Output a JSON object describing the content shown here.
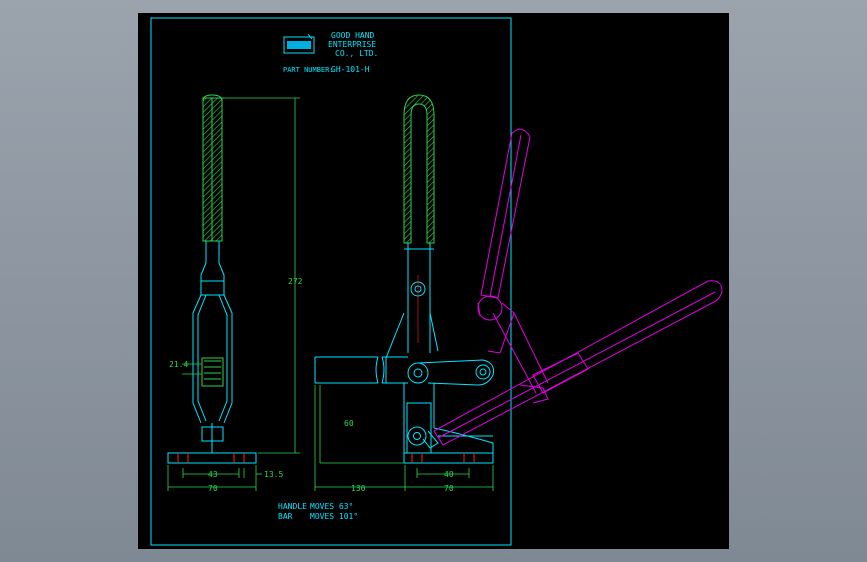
{
  "title_block": {
    "company_line1": "GOOD HAND",
    "company_line2": "ENTERPRISE",
    "company_line3": "CO., LTD.",
    "part_number_label": "PART NUMBER:",
    "part_number": "GH-101-H"
  },
  "dimensions": {
    "height": "272",
    "side_width": "21.4",
    "base_holes": "43",
    "base_edge": "13.5",
    "base_width_left": "70",
    "spindle_height": "60",
    "arm_length": "130",
    "front_holes": "40",
    "base_width_right": "70"
  },
  "notes": {
    "handle_label": "HANDLE",
    "handle_value": "MOVES 63°",
    "bar_label": "BAR",
    "bar_value": "MOVES 101°"
  },
  "colors": {
    "frame": "#00e5ff",
    "dimension": "#29d84a",
    "grip_hatch": "#2bd34a",
    "alternate_position": "#e000e0",
    "outline": "#00e5ff",
    "background": "#000000"
  }
}
